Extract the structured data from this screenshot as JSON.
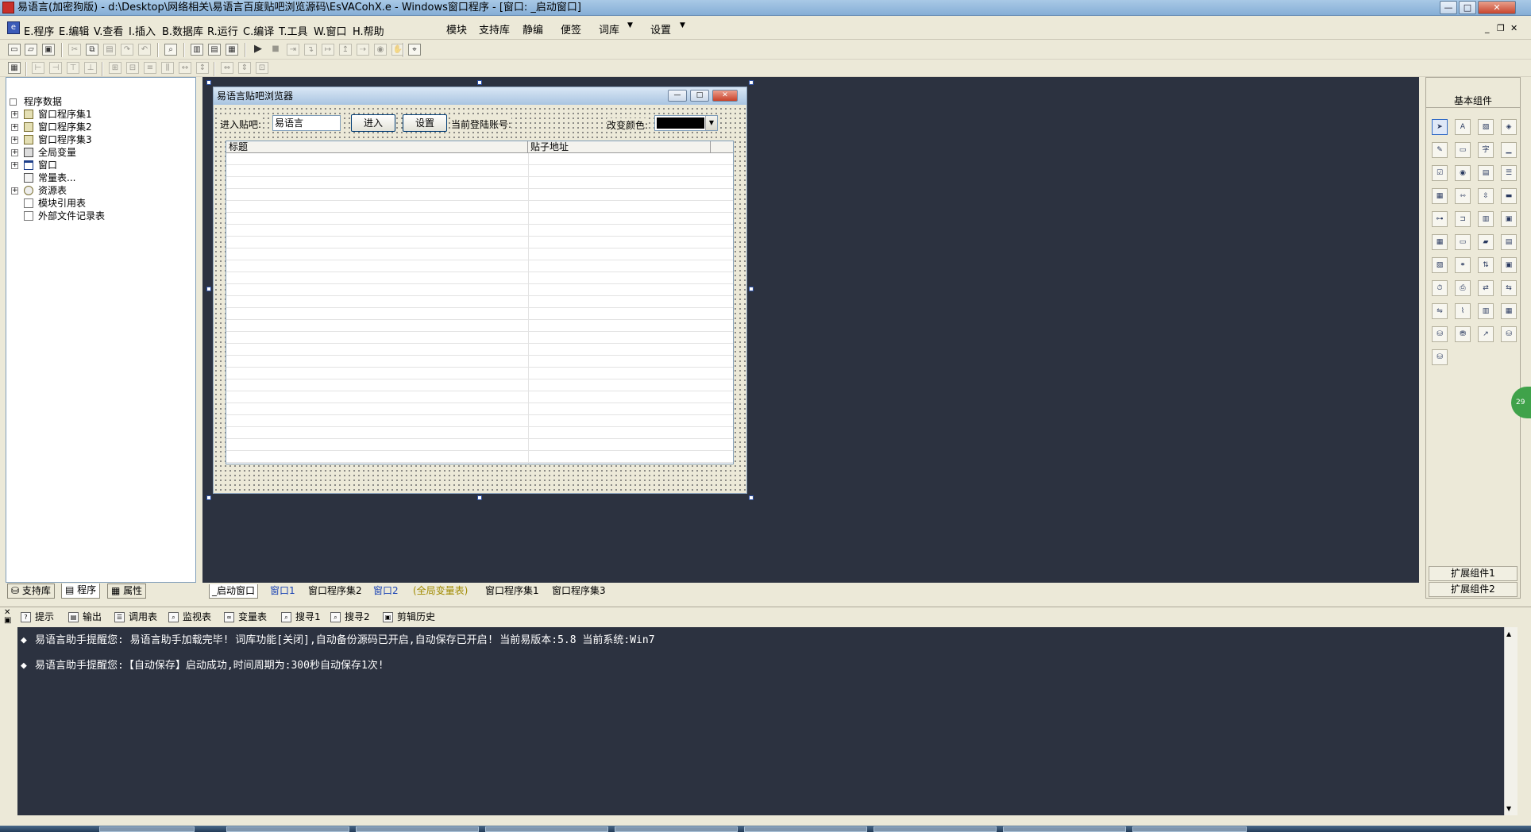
{
  "window": {
    "title": "易语言(加密狗版) - d:\\Desktop\\网络相关\\易语言百度贴吧浏览源码\\EsVACohX.e - Windows窗口程序 - [窗口: _启动窗口]",
    "controls": [
      "—",
      "□",
      "✕"
    ]
  },
  "menubar": {
    "items": [
      "E.程序",
      "E.编辑",
      "V.查看",
      "I.插入",
      "B.数据库",
      "R.运行",
      "C.编译",
      "T.工具",
      "W.窗口",
      "H.帮助"
    ],
    "extra": [
      "模块",
      "支持库",
      "静编",
      "便签",
      "词库",
      "设置"
    ]
  },
  "left_panel": {
    "tree": [
      {
        "label": "程序数据",
        "level": 0,
        "expander": ""
      },
      {
        "label": "窗口程序集1",
        "level": 1,
        "expander": "+"
      },
      {
        "label": "窗口程序集2",
        "level": 1,
        "expander": "+"
      },
      {
        "label": "窗口程序集3",
        "level": 1,
        "expander": "+"
      },
      {
        "label": "全局变量",
        "level": 1,
        "expander": "+"
      },
      {
        "label": "窗口",
        "level": 1,
        "expander": "+"
      },
      {
        "label": "常量表...",
        "level": 1,
        "expander": ""
      },
      {
        "label": "资源表",
        "level": 1,
        "expander": "+"
      },
      {
        "label": "模块引用表",
        "level": 1,
        "expander": ""
      },
      {
        "label": "外部文件记录表",
        "level": 1,
        "expander": ""
      }
    ],
    "tabs": [
      "支持库",
      "程序",
      "属性"
    ]
  },
  "form": {
    "title": "易语言贴吧浏览器",
    "enter_label": "进入贴吧:",
    "enter_value": "易语言",
    "enter_button": "进入",
    "settings_button": "设置",
    "account_label": "当前登陆账号:",
    "color_label": "改变颜色:",
    "columns": [
      "标题",
      "贴子地址"
    ]
  },
  "editor_tabs": [
    "_启动窗口",
    "窗口1",
    "窗口程序集2",
    "窗口2",
    "(全局变量表)",
    "窗口程序集1",
    "窗口程序集3"
  ],
  "right_panel": {
    "header": "基本组件",
    "footer": [
      "扩展组件1",
      "扩展组件2"
    ],
    "badge": "29"
  },
  "output": {
    "tabs": [
      "提示",
      "输出",
      "调用表",
      "监视表",
      "变量表",
      "搜寻1",
      "搜寻2",
      "剪辑历史"
    ],
    "lines": [
      "易语言助手提醒您:  易语言助手加载完毕! 词库功能[关闭],自动备份源码已开启,自动保存已开启! 当前易版本:5.8  当前系统:Win7",
      "易语言助手提醒您:【自动保存】启动成功,时间周期为:300秒自动保存1次!"
    ]
  },
  "colors": {
    "design_bg": "#2c3240",
    "output_bg": "#2c3240",
    "panel_bg": "#ece9d8",
    "color_swatch": "#000000"
  }
}
